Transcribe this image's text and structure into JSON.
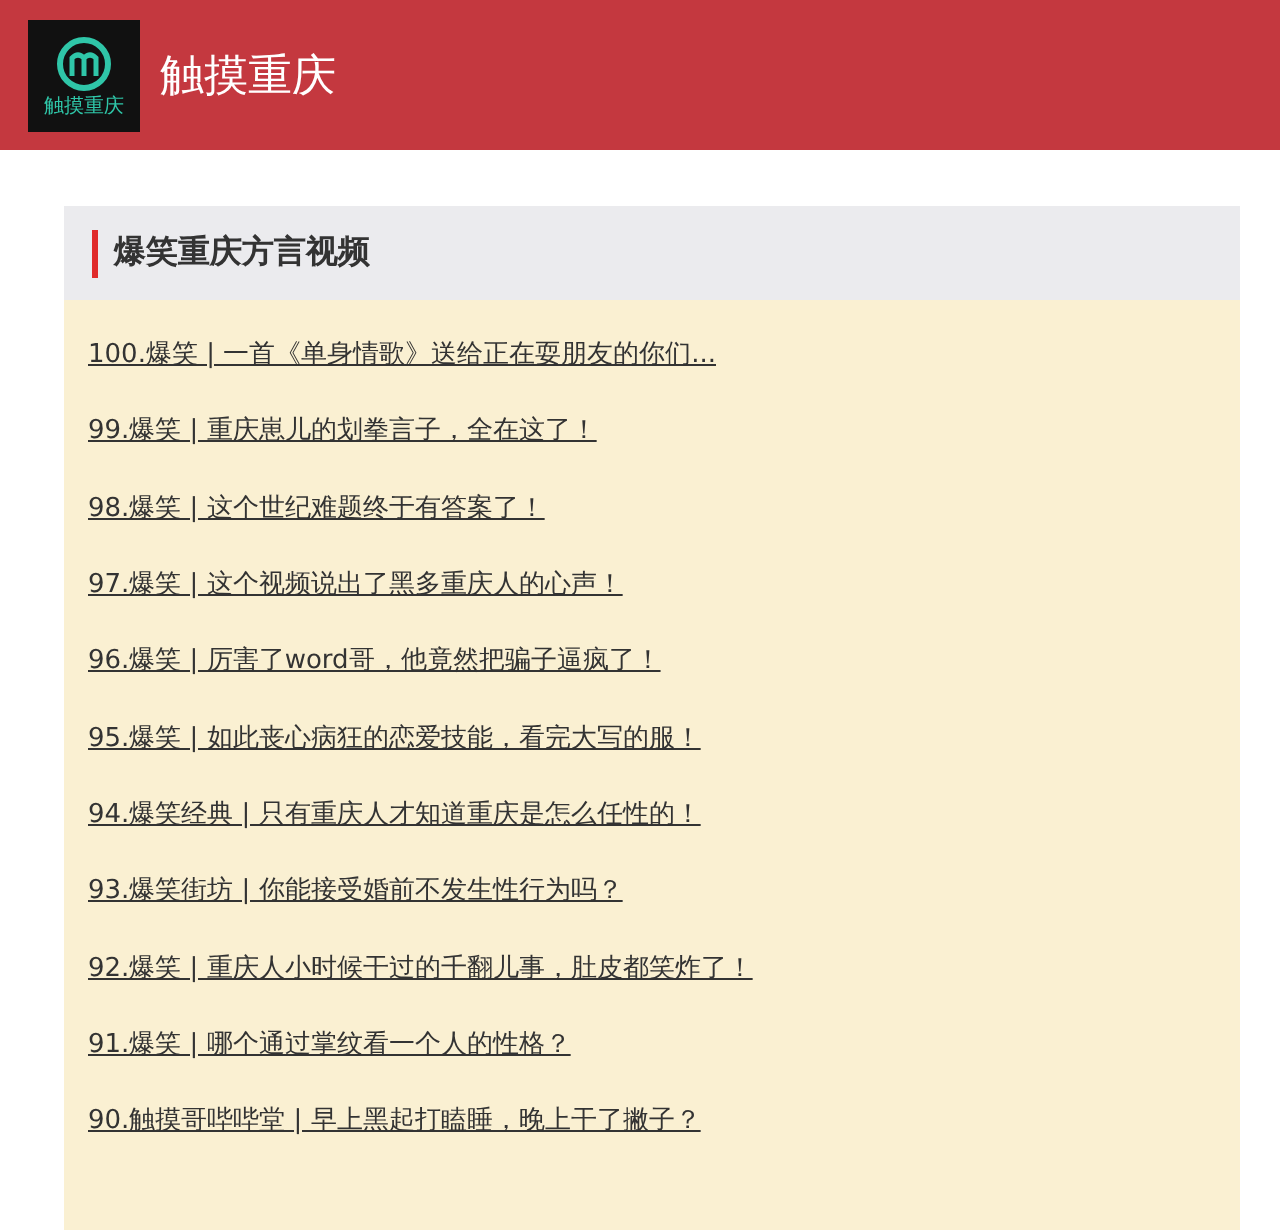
{
  "header": {
    "logo_text": "触摸重庆",
    "title": "触摸重庆"
  },
  "section": {
    "title": "爆笑重庆方言视频",
    "links": [
      "100.爆笑 | 一首《单身情歌》送给正在耍朋友的你们...",
      "99.爆笑 | 重庆崽儿的划拳言子，全在这了！",
      "98.爆笑 | 这个世纪难题终于有答案了！",
      "97.爆笑 | 这个视频说出了黑多重庆人的心声！",
      "96.爆笑 | 厉害了word哥，他竟然把骗子逼疯了！",
      "95.爆笑 | 如此丧心病狂的恋爱技能，看完大写的服！",
      "94.爆笑经典 | 只有重庆人才知道重庆是怎么任性的！",
      "93.爆笑街坊 | 你能接受婚前不发生性行为吗？",
      "92.爆笑 | 重庆人小时候干过的千翻儿事，肚皮都笑炸了！",
      "91.爆笑 | 哪个通过掌纹看一个人的性格？",
      "90.触摸哥哔哔堂 | 早上黑起打瞌睡，晚上干了撇子？"
    ]
  }
}
